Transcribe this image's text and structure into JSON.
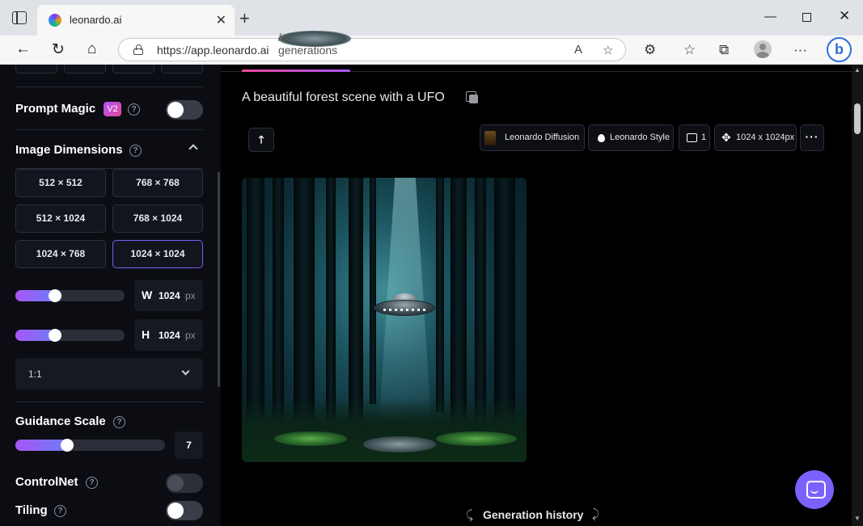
{
  "browser": {
    "tab_title": "leonardo.ai",
    "tab_close": "✕",
    "new_tab": "+",
    "url_host": "https://app.leonardo.ai",
    "url_path": "/ai-generations",
    "bing_label": "b"
  },
  "sidebar": {
    "prompt_magic": {
      "label": "Prompt Magic",
      "badge": "V2",
      "enabled": false
    },
    "image_dimensions": {
      "label": "Image Dimensions",
      "presets": [
        "512 × 512",
        "768 × 768",
        "512 × 1024",
        "768 × 1024",
        "1024 × 768",
        "1024 × 1024"
      ],
      "selected": "1024 × 1024",
      "width": {
        "label": "W",
        "value": "1024",
        "unit": "px",
        "fraction": 0.3
      },
      "height": {
        "label": "H",
        "value": "1024",
        "unit": "px",
        "fraction": 0.3
      },
      "aspect_ratio": "1:1"
    },
    "guidance_scale": {
      "label": "Guidance Scale",
      "value": "7",
      "fraction": 0.3
    },
    "controlnet": {
      "label": "ControlNet",
      "enabled": false
    },
    "tiling": {
      "label": "Tiling",
      "enabled": false
    },
    "help_glyph": "?"
  },
  "main": {
    "prompt": "A beautiful forest scene with a UFO",
    "upload_glyph": "🡑",
    "chips": {
      "model": "Leonardo Diffusion",
      "style": "Leonardo Style",
      "count": "1",
      "size": "1024 x 1024px"
    },
    "more_glyph": "···",
    "generation_history": "Generation history"
  },
  "colors": {
    "accent": "#7c5cf0",
    "chat": "#7b61ff"
  }
}
